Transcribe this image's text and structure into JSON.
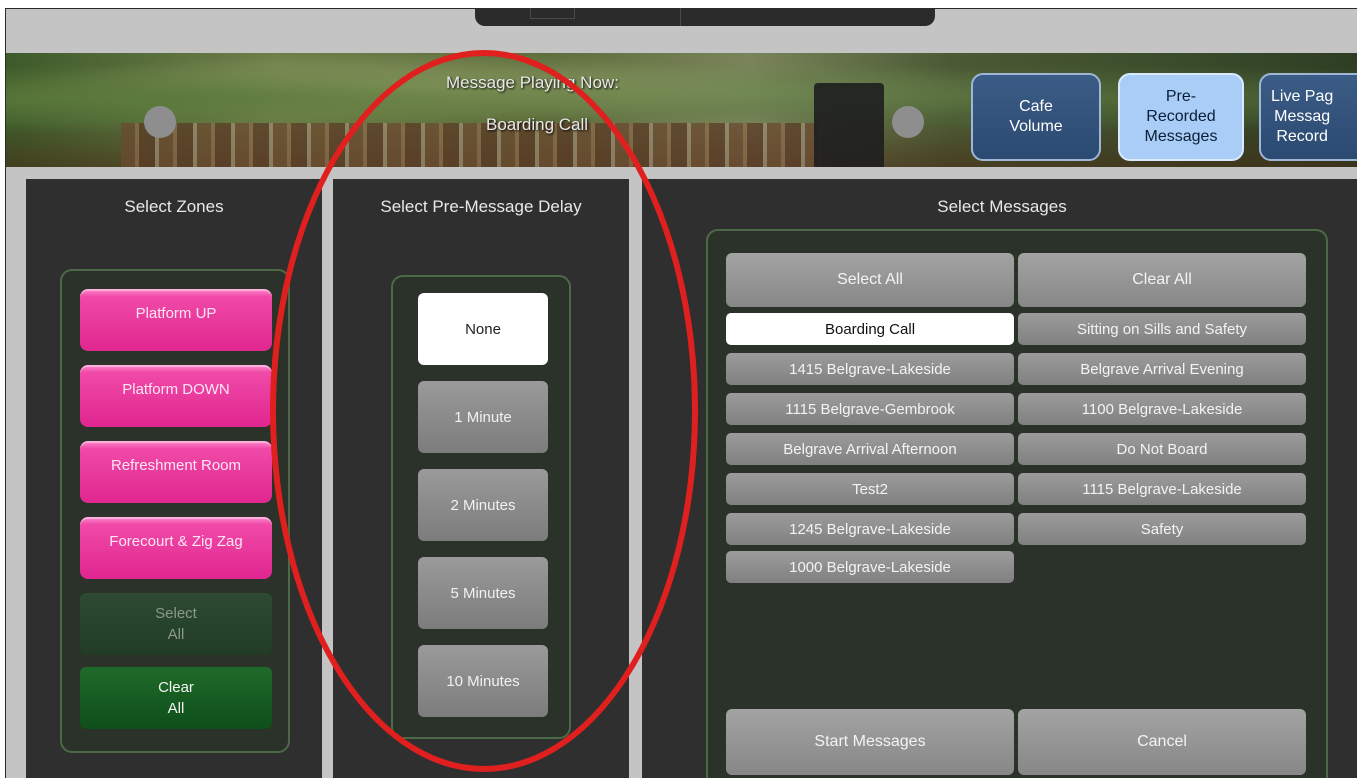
{
  "header": {
    "message_playing_label": "Message Playing Now:",
    "current_message": "Boarding Call",
    "buttons": [
      {
        "label": "Cafe\nVolume",
        "active": false
      },
      {
        "label": "Pre-\nRecorded\nMessages",
        "active": true
      },
      {
        "label": "Live Pag\nMessag\nRecord",
        "active": false
      }
    ]
  },
  "zones": {
    "title": "Select Zones",
    "items": [
      {
        "label": "Platform UP"
      },
      {
        "label": "Platform DOWN"
      },
      {
        "label": "Refreshment Room"
      },
      {
        "label": "Forecourt & Zig Zag"
      }
    ],
    "select_all": "Select\nAll",
    "clear_all": "Clear\nAll"
  },
  "delay": {
    "title": "Select Pre-Message Delay",
    "options": [
      "None",
      "1 Minute",
      "2 Minutes",
      "5 Minutes",
      "10 Minutes"
    ],
    "selected": "None"
  },
  "messages": {
    "title": "Select Messages",
    "select_all": "Select All",
    "clear_all": "Clear All",
    "left_column": [
      "Boarding Call",
      "1415 Belgrave-Lakeside",
      "1115 Belgrave-Gembrook",
      "Belgrave Arrival Afternoon",
      "Test2",
      "1245 Belgrave-Lakeside",
      "1000 Belgrave-Lakeside"
    ],
    "right_column": [
      "Sitting on Sills and Safety",
      "Belgrave Arrival Evening",
      "1100 Belgrave-Lakeside",
      "Do Not Board",
      "1115 Belgrave-Lakeside",
      "Safety"
    ],
    "selected": "Boarding Call",
    "start": "Start Messages",
    "cancel": "Cancel"
  },
  "colors": {
    "annotation": "#e0201e",
    "zone_pink": "#e0268f",
    "header_button": "#2b4a72",
    "header_button_active": "#a9cdf7"
  }
}
